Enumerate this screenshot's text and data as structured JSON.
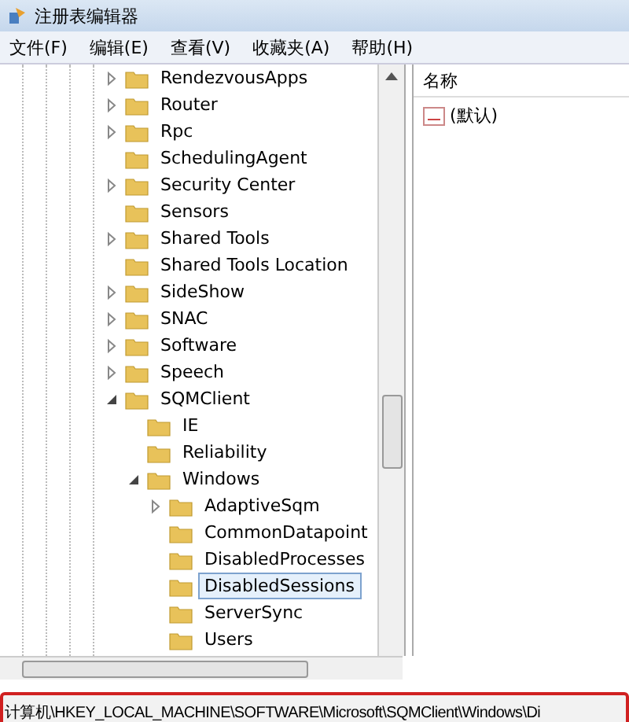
{
  "window": {
    "title": "注册表编辑器"
  },
  "menu": [
    "文件(F)",
    "编辑(E)",
    "查看(V)",
    "收藏夹(A)",
    "帮助(H)"
  ],
  "tree": [
    {
      "label": "RendezvousApps",
      "expanded": false,
      "selected": false
    },
    {
      "label": "Router",
      "expanded": false,
      "selected": false
    },
    {
      "label": "Rpc",
      "expanded": false,
      "selected": false
    },
    {
      "label": "SchedulingAgent",
      "selected": false
    },
    {
      "label": "Security Center",
      "expanded": false,
      "selected": false
    },
    {
      "label": "Sensors",
      "selected": false
    },
    {
      "label": "Shared Tools",
      "expanded": false,
      "selected": false
    },
    {
      "label": "Shared Tools Location",
      "selected": false
    },
    {
      "label": "SideShow",
      "expanded": false,
      "selected": false
    },
    {
      "label": "SNAC",
      "expanded": false,
      "selected": false
    },
    {
      "label": "Software",
      "expanded": false,
      "selected": false
    },
    {
      "label": "Speech",
      "expanded": false,
      "selected": false
    },
    {
      "label": "SQMClient",
      "expanded": true,
      "selected": false,
      "children": [
        {
          "label": "IE",
          "selected": false
        },
        {
          "label": "Reliability",
          "selected": false
        },
        {
          "label": "Windows",
          "expanded": true,
          "selected": false,
          "children": [
            {
              "label": "AdaptiveSqm",
              "expanded": false,
              "selected": false
            },
            {
              "label": "CommonDatapoint",
              "selected": false
            },
            {
              "label": "DisabledProcesses",
              "selected": false
            },
            {
              "label": "DisabledSessions",
              "selected": true
            },
            {
              "label": "ServerSync",
              "selected": false
            },
            {
              "label": "Users",
              "selected": false
            }
          ]
        }
      ]
    }
  ],
  "values": {
    "columns": [
      "名称"
    ],
    "rows": [
      {
        "name": "(默认)"
      }
    ]
  },
  "status_bar": "计算机\\HKEY_LOCAL_MACHINE\\SOFTWARE\\Microsoft\\SQMClient\\Windows\\Di"
}
